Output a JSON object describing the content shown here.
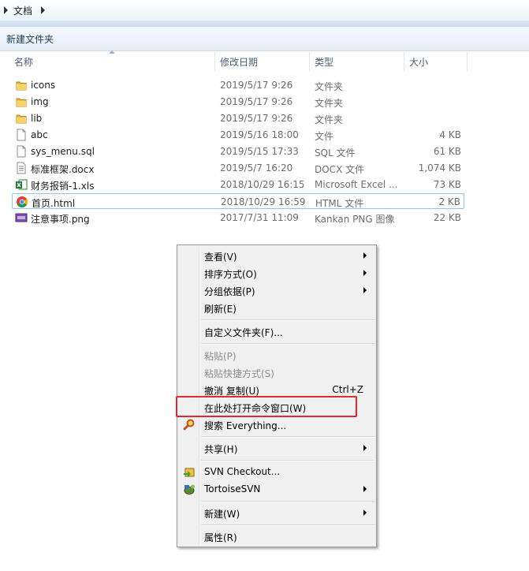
{
  "breadcrumb": {
    "folder": "文档"
  },
  "toolbar": {
    "new_folder": "新建文件夹"
  },
  "columns": {
    "name": "名称",
    "date": "修改日期",
    "type": "类型",
    "size": "大小"
  },
  "files": [
    {
      "name": "icons",
      "date": "2019/5/17 9:26",
      "type": "文件夹",
      "size": "",
      "icon": "folder-icon"
    },
    {
      "name": "img",
      "date": "2019/5/17 9:26",
      "type": "文件夹",
      "size": "",
      "icon": "folder-icon"
    },
    {
      "name": "lib",
      "date": "2019/5/17 9:26",
      "type": "文件夹",
      "size": "",
      "icon": "folder-icon"
    },
    {
      "name": "abc",
      "date": "2019/5/16 18:00",
      "type": "文件",
      "size": "4 KB",
      "icon": "file-icon"
    },
    {
      "name": "sys_menu.sql",
      "date": "2019/5/15 17:33",
      "type": "SQL 文件",
      "size": "61 KB",
      "icon": "file-icon"
    },
    {
      "name": "标准框架.docx",
      "date": "2019/5/7 16:20",
      "type": "DOCX 文件",
      "size": "1,074 KB",
      "icon": "document-icon"
    },
    {
      "name": "财务报销-1.xls",
      "date": "2018/10/29 16:15",
      "type": "Microsoft Excel ...",
      "size": "73 KB",
      "icon": "excel-icon"
    },
    {
      "name": "首页.html",
      "date": "2018/10/29 16:59",
      "type": "HTML 文件",
      "size": "2 KB",
      "icon": "chrome-icon"
    },
    {
      "name": "注意事项.png",
      "date": "2017/7/31 11:09",
      "type": "Kankan PNG 图像",
      "size": "22 KB",
      "icon": "image-icon"
    }
  ],
  "context_menu": {
    "view": "查看(V)",
    "sort_by": "排序方式(O)",
    "group_by": "分组依据(P)",
    "refresh": "刷新(E)",
    "customize_folder": "自定义文件夹(F)...",
    "paste": "粘贴(P)",
    "paste_shortcut": "粘贴快捷方式(S)",
    "undo_copy": "撤消 复制(U)",
    "undo_shortcut": "Ctrl+Z",
    "open_cmd": "在此处打开命令窗口(W)",
    "search_everything": "搜索 Everything...",
    "share": "共享(H)",
    "svn_checkout": "SVN Checkout...",
    "tortoise_svn": "TortoiseSVN",
    "new": "新建(W)",
    "properties": "属性(R)"
  },
  "colors": {
    "highlight": "#e0282e",
    "selection": "#99c4e8"
  }
}
